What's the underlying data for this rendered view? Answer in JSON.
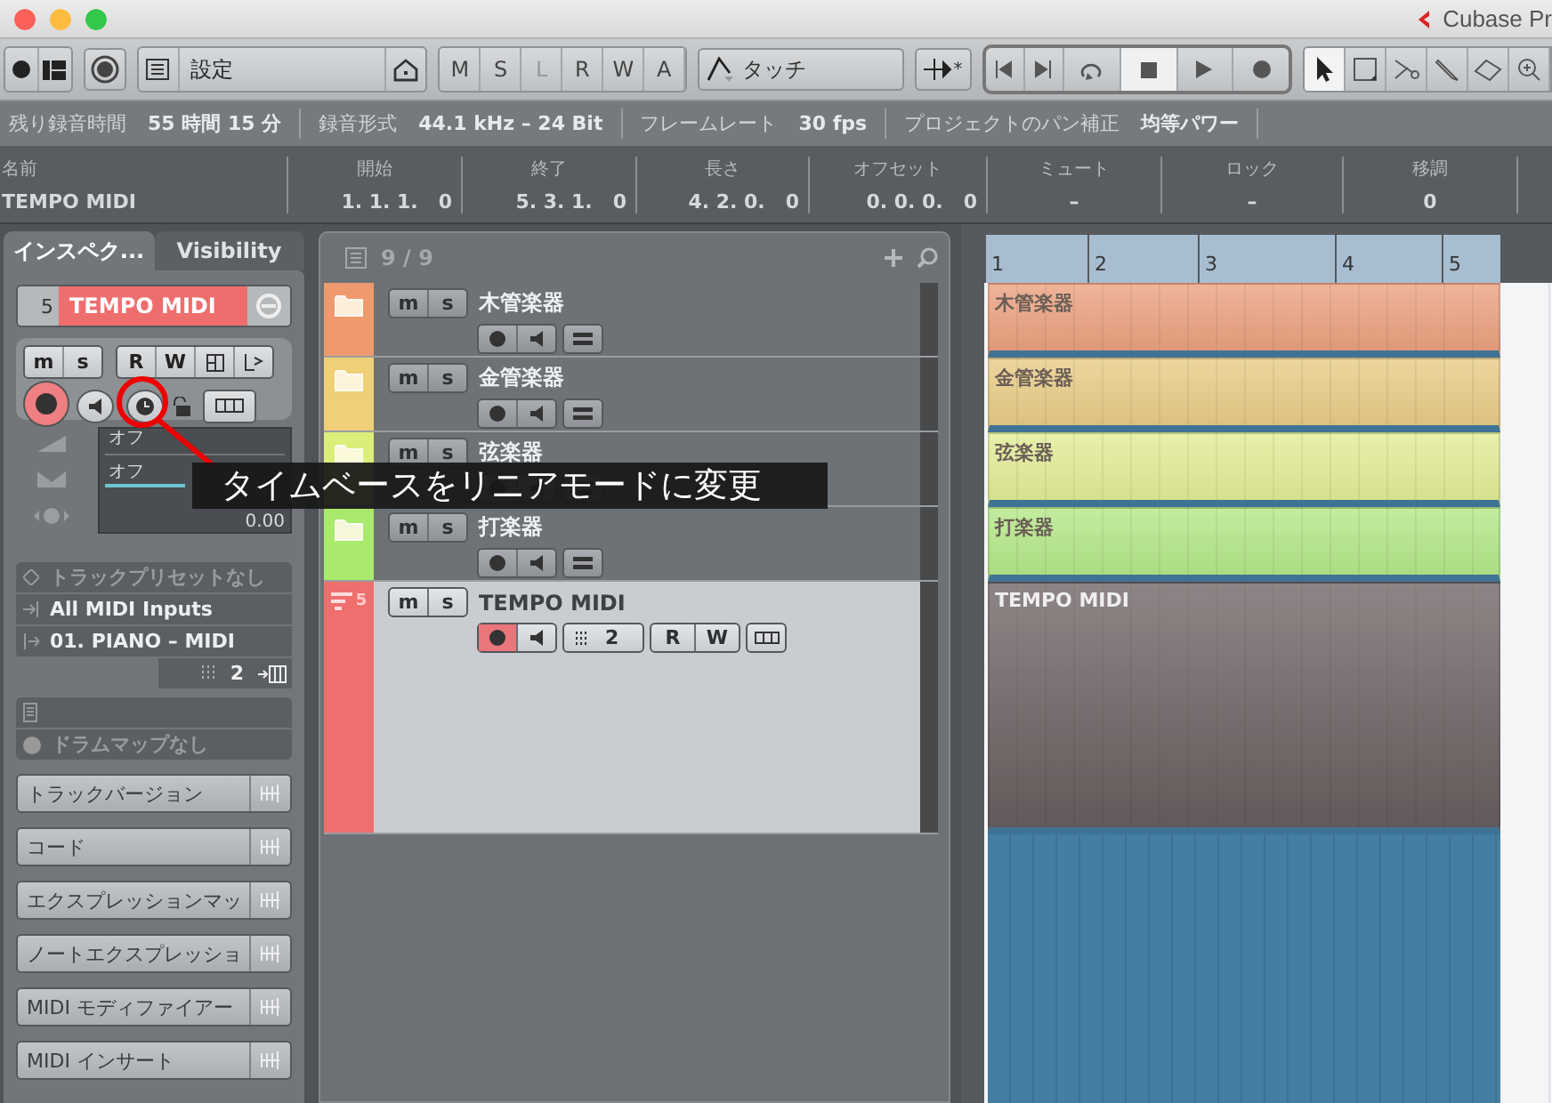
{
  "window": {
    "title": "Cubase Pr"
  },
  "toolbar": {
    "preset": "設定",
    "automation_buttons": [
      {
        "label": "M",
        "disabled": false
      },
      {
        "label": "S",
        "disabled": false
      },
      {
        "label": "L",
        "disabled": true
      },
      {
        "label": "R",
        "disabled": false
      },
      {
        "label": "W",
        "disabled": false
      },
      {
        "label": "A",
        "disabled": false
      }
    ],
    "automation_mode": "タッチ",
    "snap_marker": "*",
    "tools": [
      {
        "kind": "pointer",
        "selected": true
      },
      {
        "kind": "range",
        "selected": false
      },
      {
        "kind": "scissors",
        "selected": false
      },
      {
        "kind": "pencil",
        "selected": false
      },
      {
        "kind": "eraser",
        "selected": false
      },
      {
        "kind": "zoom",
        "selected": false
      }
    ]
  },
  "status_line": [
    {
      "label": "残り録音時間",
      "value": "55 時間 15 分"
    },
    {
      "label": "録音形式",
      "value": "44.1 kHz – 24 Bit"
    },
    {
      "label": "フレームレート",
      "value": "30 fps"
    },
    {
      "label": "プロジェクトのパン補正",
      "value": "均等パワー"
    }
  ],
  "info_line": [
    {
      "header": "名前",
      "value": "TEMPO MIDI"
    },
    {
      "header": "開始",
      "value": "1. 1. 1.   0"
    },
    {
      "header": "終了",
      "value": "5. 3. 1.   0"
    },
    {
      "header": "長さ",
      "value": "4. 2. 0.   0"
    },
    {
      "header": "オフセット",
      "value": "0. 0. 0.   0"
    },
    {
      "header": "ミュート",
      "value": "–"
    },
    {
      "header": "ロック",
      "value": "–"
    },
    {
      "header": "移調",
      "value": "0"
    }
  ],
  "inspector": {
    "tabs": [
      {
        "label": "インスペク...",
        "selected": true
      },
      {
        "label": "Visibility",
        "selected": false
      }
    ],
    "track": {
      "number": "5",
      "name": "TEMPO MIDI",
      "color": "#ee6e6e"
    },
    "buttons": {
      "mute": "m",
      "solo": "s",
      "read": "R",
      "write": "W"
    },
    "record": true,
    "fader": {
      "volume": "オフ",
      "pan": "オフ",
      "delay": "0.00"
    },
    "preset": "トラックプリセットなし",
    "input": "All MIDI Inputs",
    "output": "01. PIANO – MIDI",
    "channel": "2",
    "drum_map": "ドラムマップなし",
    "sections": [
      "トラックバージョン",
      "コード",
      "エクスプレッションマッ",
      "ノートエクスプレッショ",
      "MIDI モディファイアー",
      "MIDI インサート"
    ]
  },
  "track_list": {
    "count": "9 / 9",
    "tracks": [
      {
        "kind": "folder",
        "name": "木管楽器",
        "color": "#ee9a6e",
        "selected": false,
        "mute": "m",
        "solo": "s"
      },
      {
        "kind": "folder",
        "name": "金管楽器",
        "color": "#efcf77",
        "selected": false,
        "mute": "m",
        "solo": "s"
      },
      {
        "kind": "folder",
        "name": "弦楽器",
        "color": "#dcee7a",
        "selected": false,
        "mute": "m",
        "solo": "s"
      },
      {
        "kind": "folder",
        "name": "打楽器",
        "color": "#a9e96c",
        "selected": false,
        "mute": "m",
        "solo": "s"
      },
      {
        "kind": "midi",
        "number": "5",
        "name": "TEMPO MIDI",
        "color": "#ee6f6e",
        "selected": true,
        "mute": "m",
        "solo": "s",
        "record": true,
        "channel": "2",
        "read": "R",
        "write": "W"
      }
    ]
  },
  "arranger": {
    "ruler": [
      "1",
      "2",
      "3",
      "4",
      "5"
    ],
    "events": [
      {
        "name": "木管楽器",
        "color": "#eba17f"
      },
      {
        "name": "金管楽器",
        "color": "#e8cb86"
      },
      {
        "name": "弦楽器",
        "color": "#e2ec95"
      },
      {
        "name": "打楽器",
        "color": "#b4e788"
      },
      {
        "name": "TEMPO MIDI",
        "color": "#7a6f70"
      }
    ]
  },
  "callout": {
    "text": "タイムベースをリニアモードに変更"
  }
}
